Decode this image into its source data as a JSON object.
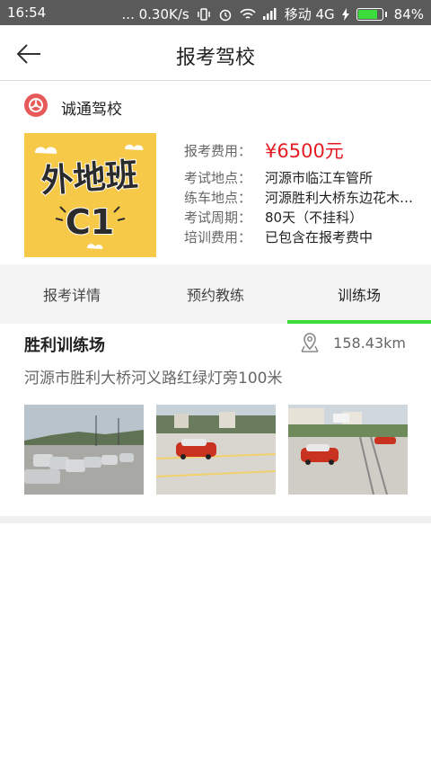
{
  "status_bar": {
    "time": "16:54",
    "speed": "... 0.30K/s",
    "carrier": "移动 4G",
    "battery": "84%",
    "battery_level": 0.84
  },
  "header": {
    "title": "报考驾校"
  },
  "school": {
    "name": "诚通驾校",
    "logo_icon": "wheel-icon"
  },
  "class_image": {
    "line1": "外地班",
    "line2": "C1"
  },
  "info": {
    "price_label": "报考费用：",
    "price": "¥6500元",
    "exam_location_label": "考试地点：",
    "exam_location": "河源市临江车管所",
    "practice_location_label": "练车地点：",
    "practice_location": "河源胜利大桥东边花木…",
    "exam_period_label": "考试周期：",
    "exam_period": "80天（不挂科）",
    "training_fee_label": "培训费用：",
    "training_fee": "已包含在报考费中"
  },
  "tabs": [
    {
      "label": "报考详情",
      "active": false
    },
    {
      "label": "预约教练",
      "active": false
    },
    {
      "label": "训练场",
      "active": true
    }
  ],
  "training_field": {
    "name": "胜利训练场",
    "distance": "158.43km",
    "address": "河源市胜利大桥河义路红绿灯旁100米"
  },
  "colors": {
    "accent": "#3ddc3d",
    "price": "#e51c23",
    "status_bar": "#5a5a5a"
  }
}
